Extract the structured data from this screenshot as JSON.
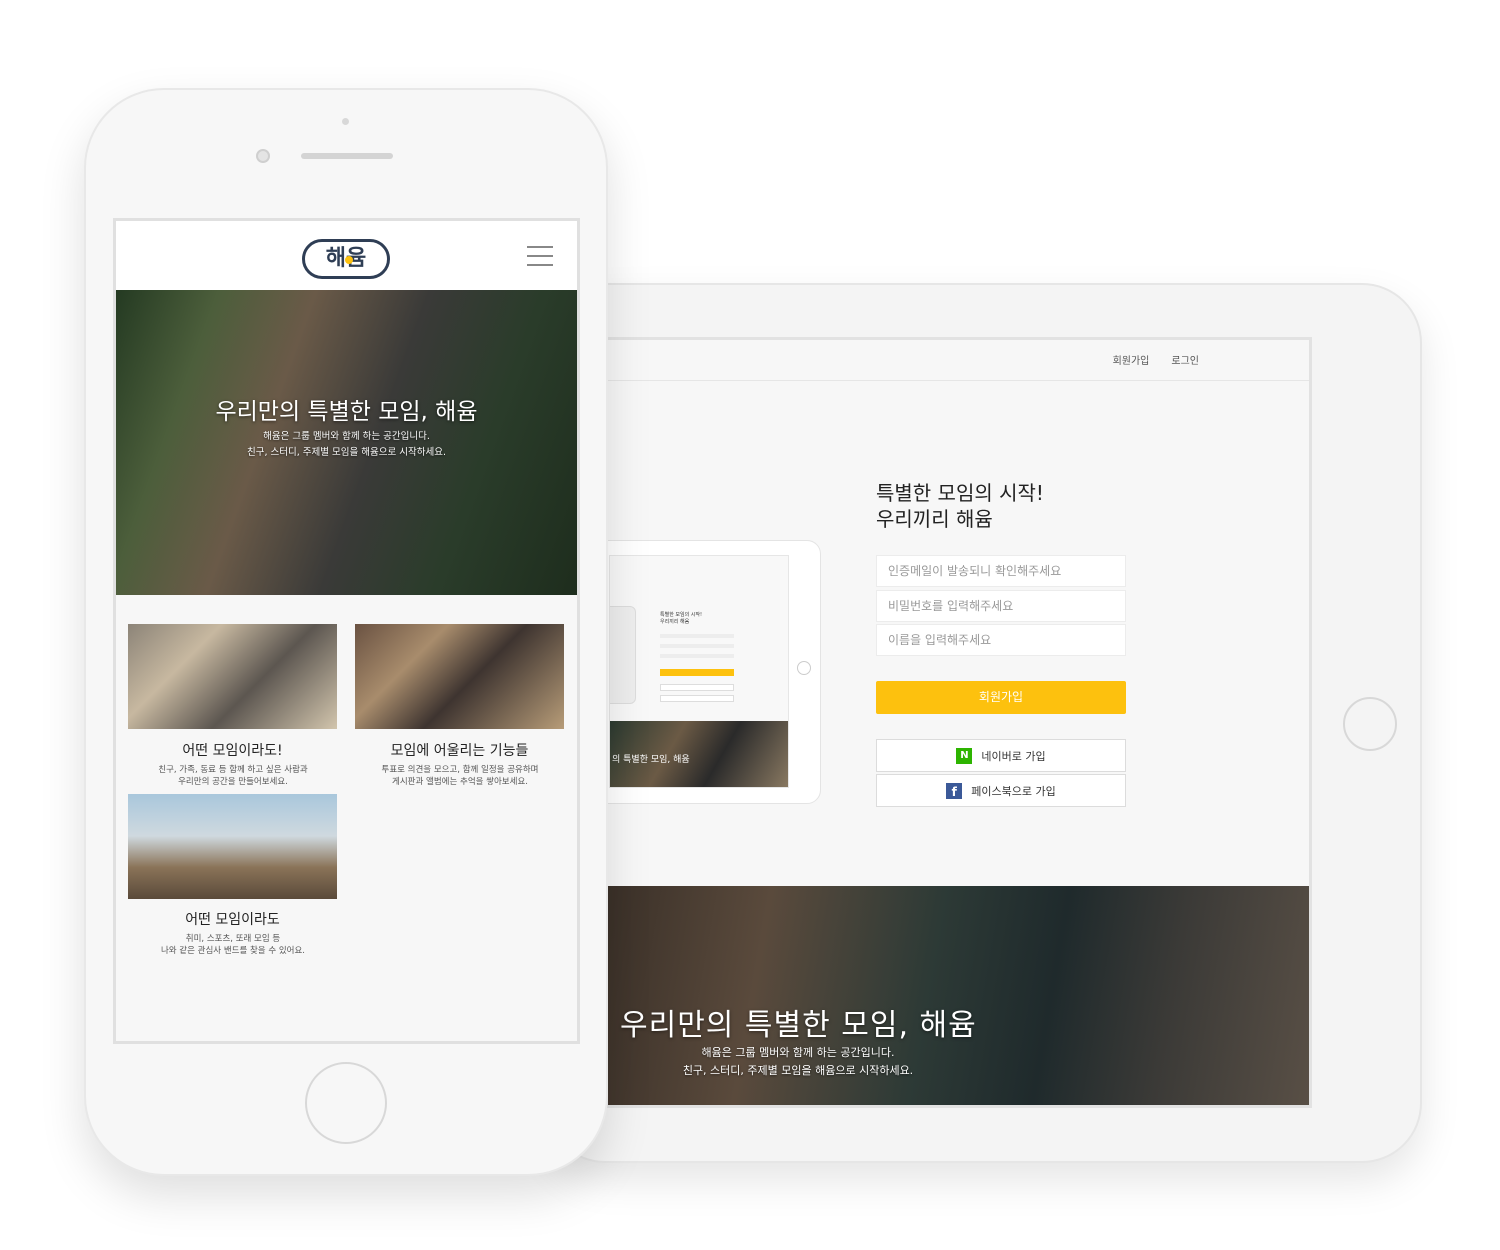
{
  "tablet": {
    "nav": {
      "signup": "회원가입",
      "login": "로그인"
    },
    "title_line1": "특별한 모임의 시작!",
    "title_line2": "우리끼리 해윰",
    "fields": [
      {
        "placeholder": "인증메일이 발송되니 확인해주세요"
      },
      {
        "placeholder": "비밀번호를 입력해주세요"
      },
      {
        "placeholder": "이름을 입력해주세요"
      }
    ],
    "signup_button": "회원가입",
    "naver_button": "네이버로 가입",
    "facebook_button": "페이스북으로 가입",
    "naver_icon": "N",
    "facebook_icon": "f",
    "hero": {
      "title": "우리만의 특별한 모임, 해윰",
      "subtitle_line1": "해윰은 그룹 멤버와 함께 하는 공간입니다.",
      "subtitle_line2": "친구, 스터디, 주제별 모임을 해윰으로 시작하세요."
    },
    "mini": {
      "title_line1": "특별한 모임의 시작!",
      "title_line2": "우리끼리 해윰",
      "hero_text": "의 특별한 모임, 해윰"
    }
  },
  "phone": {
    "logo": "해윰",
    "hero": {
      "title": "우리만의 특별한 모임, 해윰",
      "subtitle_line1": "해윰은 그룹 멤버와 함께 하는 공간입니다.",
      "subtitle_line2": "친구, 스터디, 주제별 모임을 해윰으로 시작하세요."
    },
    "cards": [
      {
        "title": "어떤 모임이라도!",
        "desc_line1": "친구, 가족, 동료 등 함께 하고 싶은 사람과",
        "desc_line2": "우리만의 공간을 만들어보세요."
      },
      {
        "title": "모임에 어울리는 기능들",
        "desc_line1": "투표로 의견을 모으고, 함께 일정을 공유하며",
        "desc_line2": "게시판과 앨범에는 추억을 쌓아보세요."
      },
      {
        "title": "어떤 모임이라도",
        "desc_line1": "취미, 스포츠, 또래 모임 등",
        "desc_line2": "나와 같은 관심사 밴드를 찾을 수 있어요."
      }
    ]
  },
  "colors": {
    "accent": "#fdc10e",
    "naver": "#2db400",
    "facebook": "#3b5998",
    "logo": "#2f3e55"
  }
}
